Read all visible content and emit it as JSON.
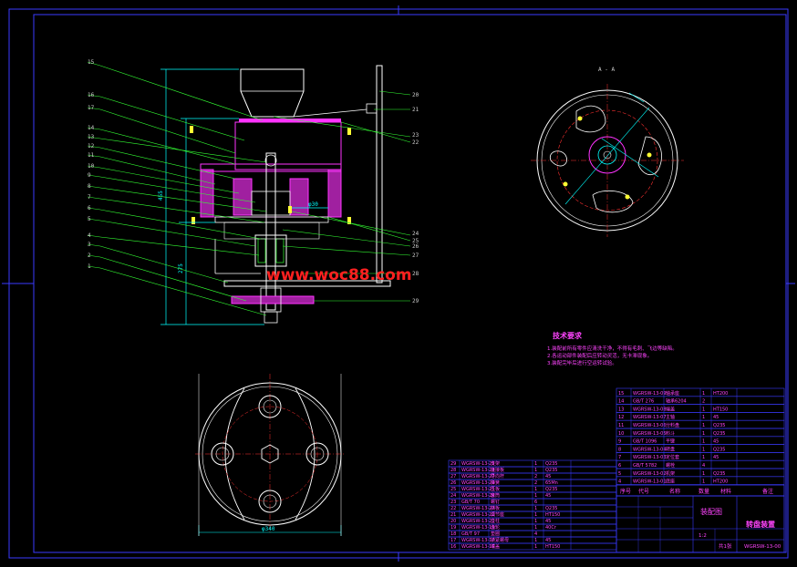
{
  "colors": {
    "background": "#000000",
    "frame": "#3a3aff",
    "outline": "#ffffff",
    "leader": "#33ff33",
    "section": "#ff33ff",
    "dimension": "#00ffff",
    "center": "#ff3030",
    "watermark": "#ff2020",
    "table_line": "#3a3aff"
  },
  "watermark": "www.woc88.com",
  "section_view_label": "A - A",
  "tech_title": "技术要求",
  "tech_notes": [
    "1.装配前所有零件应清洗干净，不得有毛刺、飞边等缺陷。",
    "2.各运动部件装配后应转动灵活，无卡滞现象。",
    "3.装配完毕后进行空运转试验。"
  ],
  "dims": {
    "overall_height": "455",
    "lower_height": "275",
    "base_dia": "φ340",
    "small_dim": "φ30"
  },
  "left_callouts": [
    "15",
    "16",
    "17",
    "14",
    "13",
    "12",
    "11",
    "10",
    "9",
    "8",
    "7",
    "6",
    "5",
    "4",
    "3",
    "2",
    "1"
  ],
  "right_callouts": [
    "20",
    "21",
    "22",
    "23",
    "24",
    "25",
    "26",
    "27",
    "28",
    "29"
  ],
  "bom_right": [
    {
      "no": "15",
      "code": "WGRSW-13-09",
      "name": "轴承座",
      "qty": "1",
      "mat": "HT200"
    },
    {
      "no": "14",
      "code": "GB/T 276",
      "name": "轴承6204",
      "qty": "2",
      "mat": ""
    },
    {
      "no": "13",
      "code": "WGRSW-13-08",
      "name": "端盖",
      "qty": "1",
      "mat": "HT150"
    },
    {
      "no": "12",
      "code": "WGRSW-13-07",
      "name": "主轴",
      "qty": "1",
      "mat": "45"
    },
    {
      "no": "11",
      "code": "WGRSW-13-06",
      "name": "分料盘",
      "qty": "1",
      "mat": "Q235"
    },
    {
      "no": "10",
      "code": "WGRSW-13-05",
      "name": "料斗",
      "qty": "1",
      "mat": "Q235"
    },
    {
      "no": "9",
      "code": "GB/T 1096",
      "name": "平键",
      "qty": "1",
      "mat": "45"
    },
    {
      "no": "8",
      "code": "WGRSW-13-04",
      "name": "转盘",
      "qty": "1",
      "mat": "Q235"
    },
    {
      "no": "7",
      "code": "WGRSW-13-03",
      "name": "定位套",
      "qty": "1",
      "mat": "45"
    },
    {
      "no": "6",
      "code": "GB/T 5782",
      "name": "螺栓",
      "qty": "4",
      "mat": ""
    },
    {
      "no": "5",
      "code": "WGRSW-13-02",
      "name": "机架",
      "qty": "1",
      "mat": "Q235"
    },
    {
      "no": "4",
      "code": "WGRSW-13-01",
      "name": "底座",
      "qty": "1",
      "mat": "HT200"
    }
  ],
  "bom_left": [
    {
      "no": "29",
      "code": "WGRSW-13-29",
      "name": "支架",
      "qty": "1",
      "mat": "Q235"
    },
    {
      "no": "28",
      "code": "WGRSW-13-28",
      "name": "连接板",
      "qty": "1",
      "mat": "Q235"
    },
    {
      "no": "27",
      "code": "WGRSW-13-27",
      "name": "导向杆",
      "qty": "2",
      "mat": "45"
    },
    {
      "no": "26",
      "code": "WGRSW-13-26",
      "name": "弹簧",
      "qty": "2",
      "mat": "65Mn"
    },
    {
      "no": "25",
      "code": "WGRSW-13-25",
      "name": "压板",
      "qty": "1",
      "mat": "Q235"
    },
    {
      "no": "24",
      "code": "WGRSW-13-24",
      "name": "套筒",
      "qty": "1",
      "mat": "45"
    },
    {
      "no": "23",
      "code": "GB/T 70",
      "name": "螺钉",
      "qty": "6",
      "mat": ""
    },
    {
      "no": "22",
      "code": "WGRSW-13-22",
      "name": "挡板",
      "qty": "1",
      "mat": "Q235"
    },
    {
      "no": "21",
      "code": "WGRSW-13-21",
      "name": "调节座",
      "qty": "1",
      "mat": "HT150"
    },
    {
      "no": "20",
      "code": "WGRSW-13-20",
      "name": "立柱",
      "qty": "1",
      "mat": "45"
    },
    {
      "no": "19",
      "code": "WGRSW-13-19",
      "name": "齿轮",
      "qty": "1",
      "mat": "40Cr"
    },
    {
      "no": "18",
      "code": "GB/T 97",
      "name": "垫圈",
      "qty": "4",
      "mat": ""
    },
    {
      "no": "17",
      "code": "WGRSW-13-17",
      "name": "锁紧螺母",
      "qty": "1",
      "mat": "45"
    },
    {
      "no": "16",
      "code": "WGRSW-13-16",
      "name": "端盖",
      "qty": "1",
      "mat": "HT150"
    }
  ],
  "bom_header": [
    "序号",
    "代号",
    "名称",
    "数量",
    "材料",
    "备注"
  ],
  "title_block": {
    "assembly_label": "装配图",
    "title": "转盘装置",
    "drawing_no": "WGRSW-13-00",
    "scale": "1:2",
    "sheet": "共1张"
  }
}
